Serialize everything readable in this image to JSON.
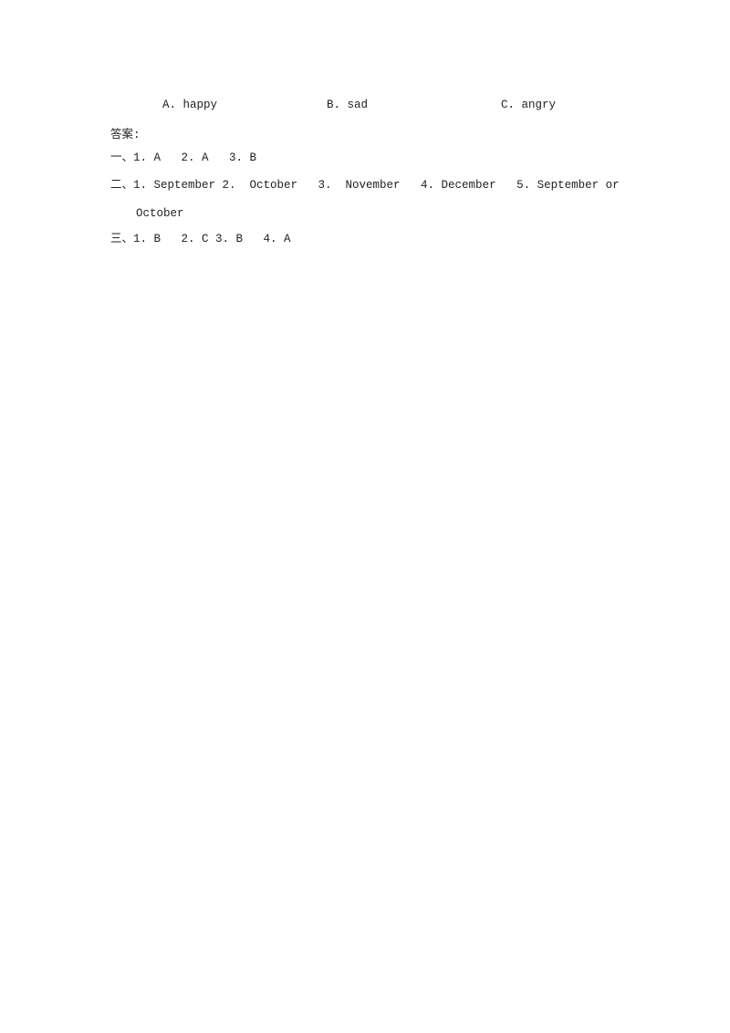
{
  "options": {
    "a": "A. happy",
    "b": "B. sad",
    "c": "C. angry"
  },
  "answers": {
    "heading": "答案:",
    "section1": "一、1. A   2. A   3. B",
    "section2_line1": "二、1. September 2.  October   3.  November   4. December   5. September or",
    "section2_line2": "October",
    "section3": "三、1. B   2. C 3. B   4. A"
  }
}
